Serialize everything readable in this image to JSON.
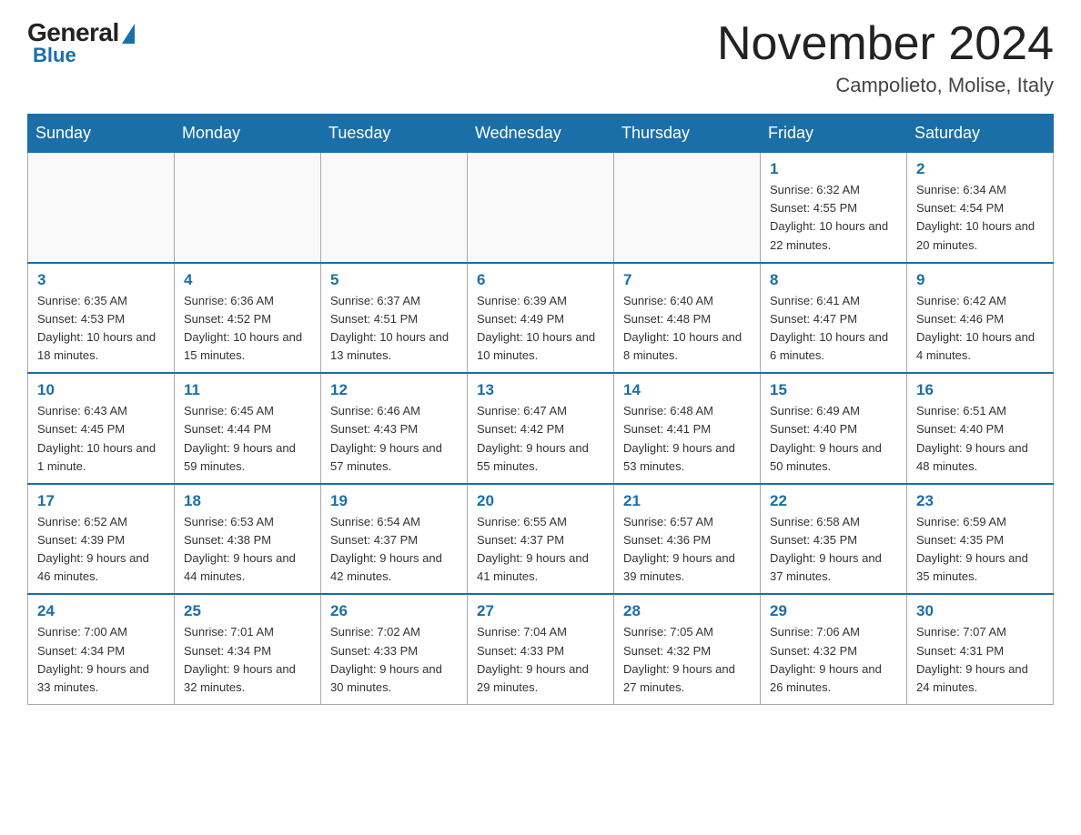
{
  "header": {
    "logo": {
      "general": "General",
      "blue": "Blue"
    },
    "title": "November 2024",
    "location": "Campolieto, Molise, Italy"
  },
  "days_of_week": [
    "Sunday",
    "Monday",
    "Tuesday",
    "Wednesday",
    "Thursday",
    "Friday",
    "Saturday"
  ],
  "weeks": [
    [
      {
        "day": "",
        "info": ""
      },
      {
        "day": "",
        "info": ""
      },
      {
        "day": "",
        "info": ""
      },
      {
        "day": "",
        "info": ""
      },
      {
        "day": "",
        "info": ""
      },
      {
        "day": "1",
        "info": "Sunrise: 6:32 AM\nSunset: 4:55 PM\nDaylight: 10 hours and 22 minutes."
      },
      {
        "day": "2",
        "info": "Sunrise: 6:34 AM\nSunset: 4:54 PM\nDaylight: 10 hours and 20 minutes."
      }
    ],
    [
      {
        "day": "3",
        "info": "Sunrise: 6:35 AM\nSunset: 4:53 PM\nDaylight: 10 hours and 18 minutes."
      },
      {
        "day": "4",
        "info": "Sunrise: 6:36 AM\nSunset: 4:52 PM\nDaylight: 10 hours and 15 minutes."
      },
      {
        "day": "5",
        "info": "Sunrise: 6:37 AM\nSunset: 4:51 PM\nDaylight: 10 hours and 13 minutes."
      },
      {
        "day": "6",
        "info": "Sunrise: 6:39 AM\nSunset: 4:49 PM\nDaylight: 10 hours and 10 minutes."
      },
      {
        "day": "7",
        "info": "Sunrise: 6:40 AM\nSunset: 4:48 PM\nDaylight: 10 hours and 8 minutes."
      },
      {
        "day": "8",
        "info": "Sunrise: 6:41 AM\nSunset: 4:47 PM\nDaylight: 10 hours and 6 minutes."
      },
      {
        "day": "9",
        "info": "Sunrise: 6:42 AM\nSunset: 4:46 PM\nDaylight: 10 hours and 4 minutes."
      }
    ],
    [
      {
        "day": "10",
        "info": "Sunrise: 6:43 AM\nSunset: 4:45 PM\nDaylight: 10 hours and 1 minute."
      },
      {
        "day": "11",
        "info": "Sunrise: 6:45 AM\nSunset: 4:44 PM\nDaylight: 9 hours and 59 minutes."
      },
      {
        "day": "12",
        "info": "Sunrise: 6:46 AM\nSunset: 4:43 PM\nDaylight: 9 hours and 57 minutes."
      },
      {
        "day": "13",
        "info": "Sunrise: 6:47 AM\nSunset: 4:42 PM\nDaylight: 9 hours and 55 minutes."
      },
      {
        "day": "14",
        "info": "Sunrise: 6:48 AM\nSunset: 4:41 PM\nDaylight: 9 hours and 53 minutes."
      },
      {
        "day": "15",
        "info": "Sunrise: 6:49 AM\nSunset: 4:40 PM\nDaylight: 9 hours and 50 minutes."
      },
      {
        "day": "16",
        "info": "Sunrise: 6:51 AM\nSunset: 4:40 PM\nDaylight: 9 hours and 48 minutes."
      }
    ],
    [
      {
        "day": "17",
        "info": "Sunrise: 6:52 AM\nSunset: 4:39 PM\nDaylight: 9 hours and 46 minutes."
      },
      {
        "day": "18",
        "info": "Sunrise: 6:53 AM\nSunset: 4:38 PM\nDaylight: 9 hours and 44 minutes."
      },
      {
        "day": "19",
        "info": "Sunrise: 6:54 AM\nSunset: 4:37 PM\nDaylight: 9 hours and 42 minutes."
      },
      {
        "day": "20",
        "info": "Sunrise: 6:55 AM\nSunset: 4:37 PM\nDaylight: 9 hours and 41 minutes."
      },
      {
        "day": "21",
        "info": "Sunrise: 6:57 AM\nSunset: 4:36 PM\nDaylight: 9 hours and 39 minutes."
      },
      {
        "day": "22",
        "info": "Sunrise: 6:58 AM\nSunset: 4:35 PM\nDaylight: 9 hours and 37 minutes."
      },
      {
        "day": "23",
        "info": "Sunrise: 6:59 AM\nSunset: 4:35 PM\nDaylight: 9 hours and 35 minutes."
      }
    ],
    [
      {
        "day": "24",
        "info": "Sunrise: 7:00 AM\nSunset: 4:34 PM\nDaylight: 9 hours and 33 minutes."
      },
      {
        "day": "25",
        "info": "Sunrise: 7:01 AM\nSunset: 4:34 PM\nDaylight: 9 hours and 32 minutes."
      },
      {
        "day": "26",
        "info": "Sunrise: 7:02 AM\nSunset: 4:33 PM\nDaylight: 9 hours and 30 minutes."
      },
      {
        "day": "27",
        "info": "Sunrise: 7:04 AM\nSunset: 4:33 PM\nDaylight: 9 hours and 29 minutes."
      },
      {
        "day": "28",
        "info": "Sunrise: 7:05 AM\nSunset: 4:32 PM\nDaylight: 9 hours and 27 minutes."
      },
      {
        "day": "29",
        "info": "Sunrise: 7:06 AM\nSunset: 4:32 PM\nDaylight: 9 hours and 26 minutes."
      },
      {
        "day": "30",
        "info": "Sunrise: 7:07 AM\nSunset: 4:31 PM\nDaylight: 9 hours and 24 minutes."
      }
    ]
  ]
}
